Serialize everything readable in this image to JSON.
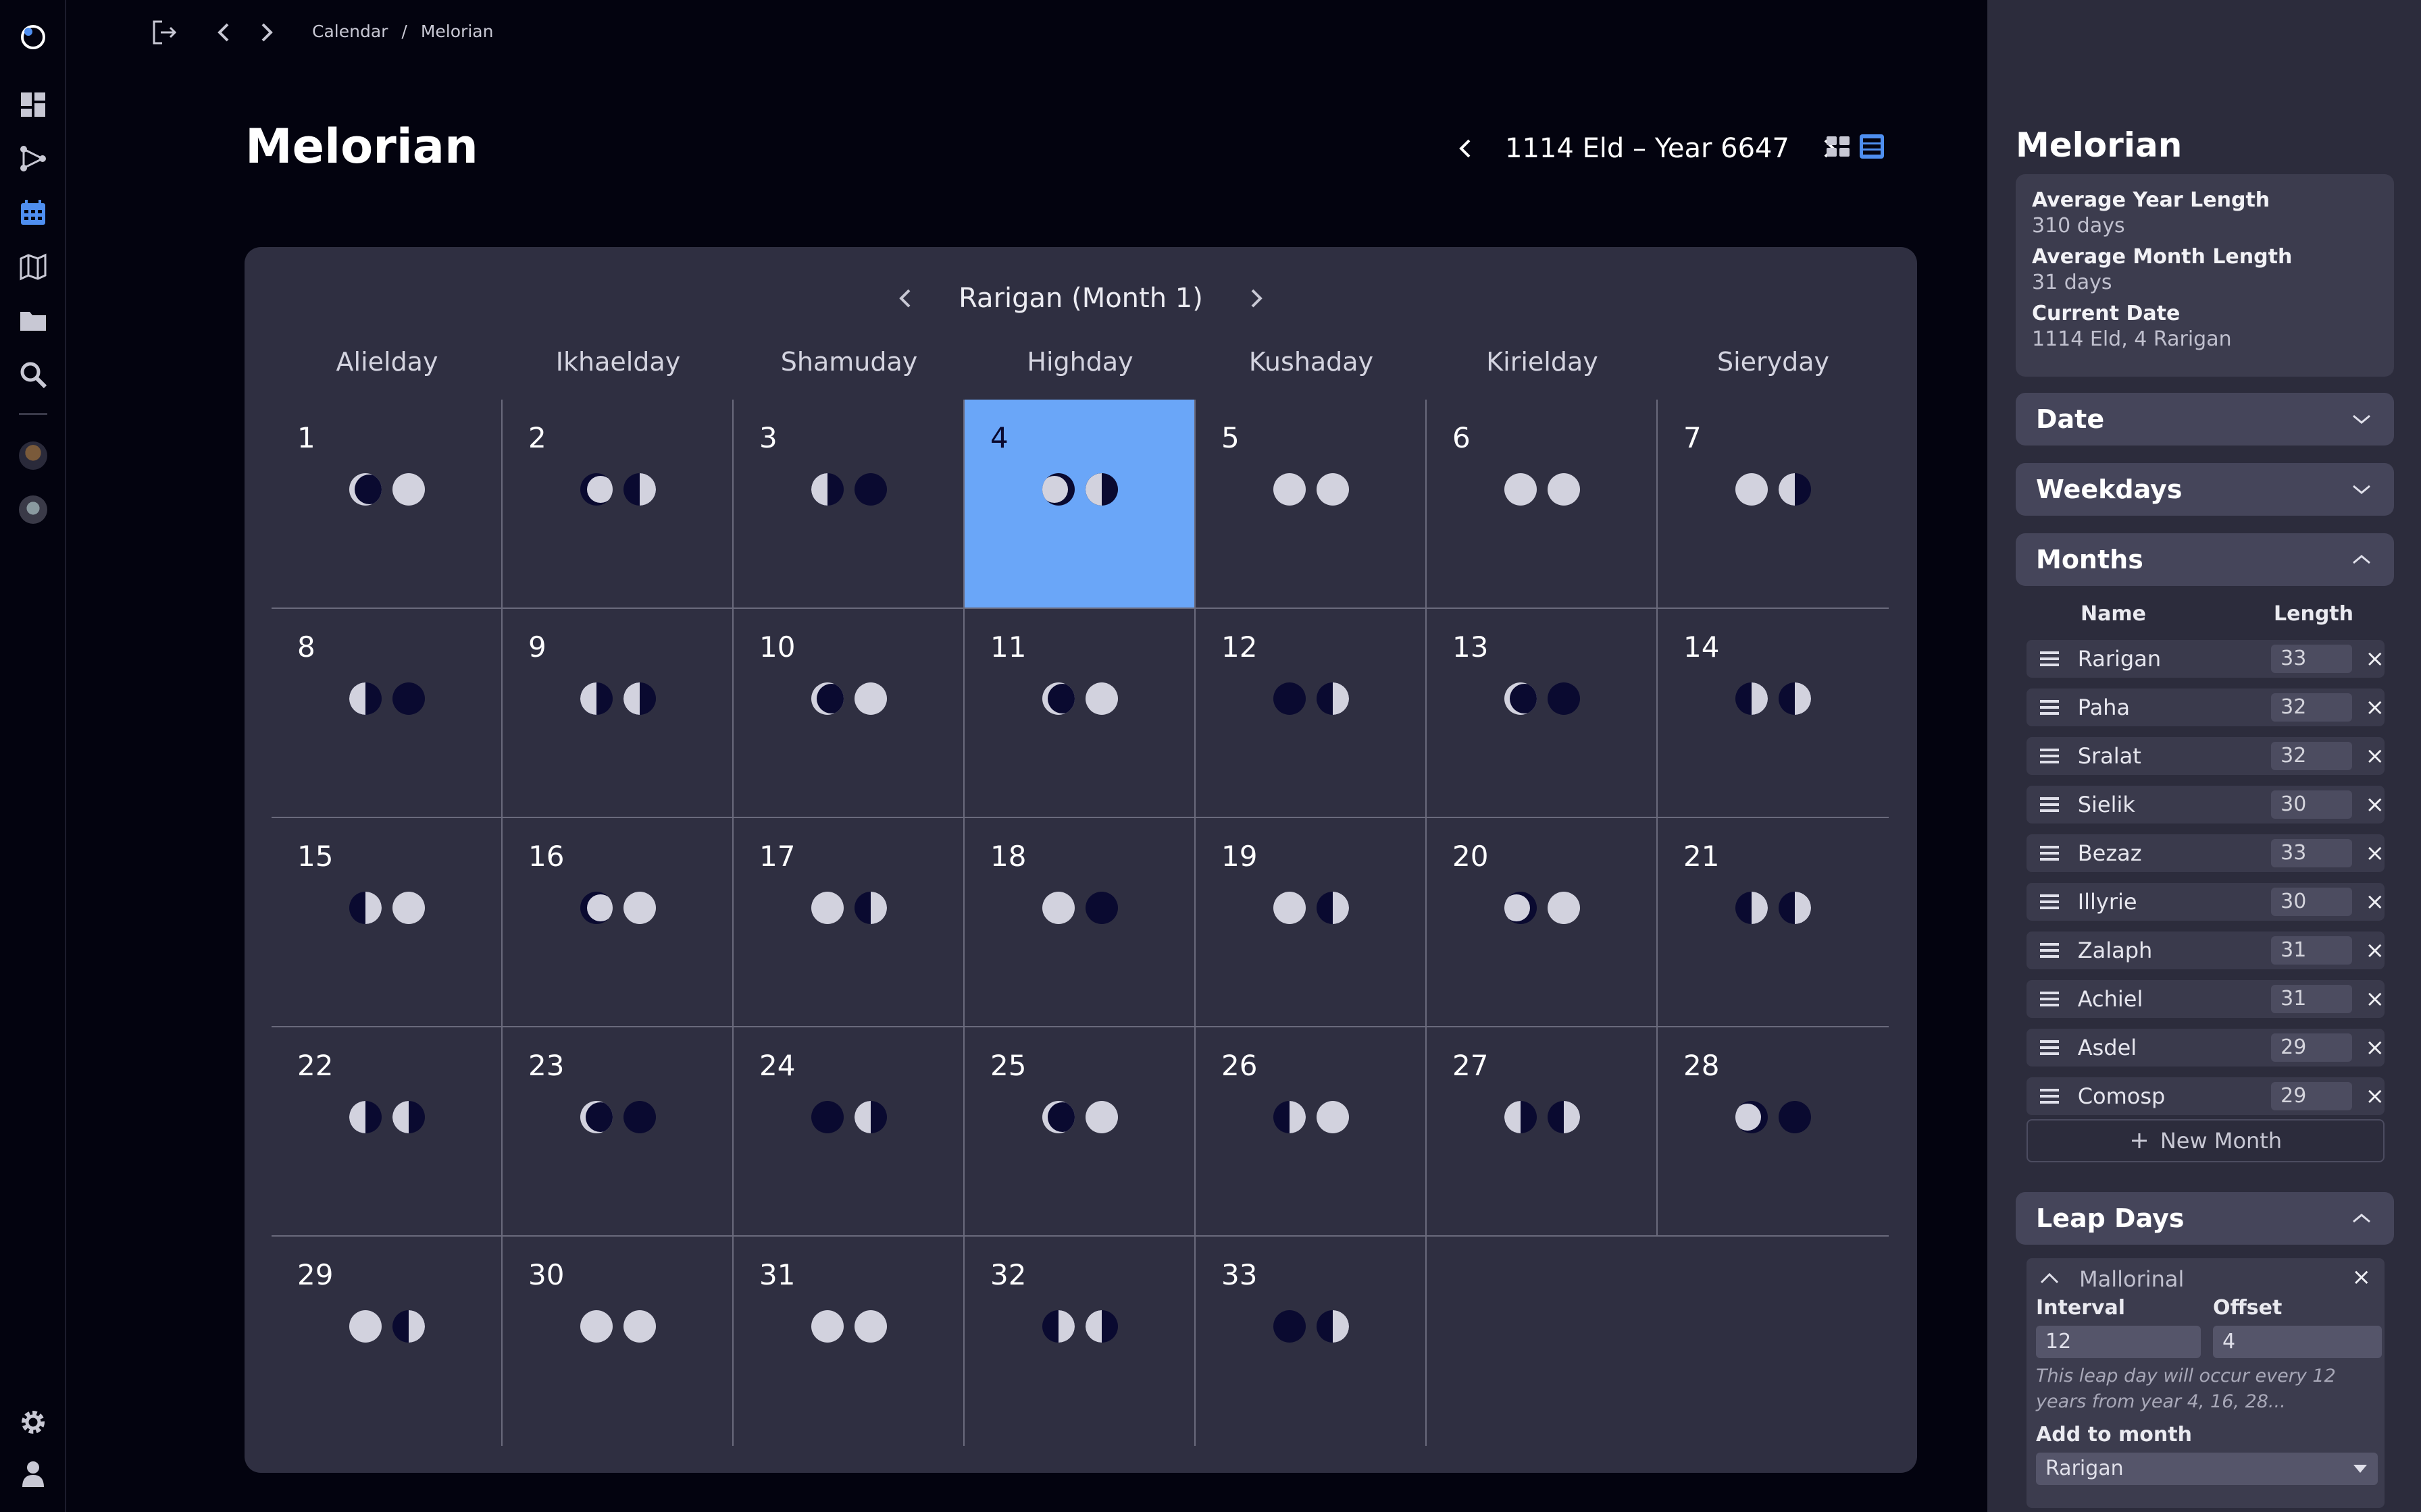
{
  "breadcrumb": [
    "Calendar",
    "/",
    "Melorian"
  ],
  "page_title": "Melorian",
  "year_label": "1114 Eld – Year 6647",
  "month_label": "Rarigan (Month 1)",
  "weekdays": [
    "Alielday",
    "Ikhaelday",
    "Shamuday",
    "Highday",
    "Kushaday",
    "Kirielday",
    "Sieryday"
  ],
  "today": 4,
  "colors": {
    "today": "#6aa6f8",
    "card": "#2f2f41",
    "moon_light": "#d2d2de",
    "moon_dark": "#0a0a30"
  },
  "days": [
    {
      "n": "1",
      "m": [
        "waxing-crescent",
        "full"
      ]
    },
    {
      "n": "2",
      "m": [
        "waxing-gibbous",
        "first-quarter"
      ]
    },
    {
      "n": "3",
      "m": [
        "last-quarter",
        "new"
      ]
    },
    {
      "n": "4",
      "m": [
        "waning-gibbous",
        "last-quarter"
      ]
    },
    {
      "n": "5",
      "m": [
        "full",
        "full"
      ]
    },
    {
      "n": "6",
      "m": [
        "full",
        "full"
      ]
    },
    {
      "n": "7",
      "m": [
        "full",
        "last-quarter"
      ]
    },
    {
      "n": "8",
      "m": [
        "last-quarter",
        "new"
      ]
    },
    {
      "n": "9",
      "m": [
        "last-quarter",
        "last-quarter"
      ]
    },
    {
      "n": "10",
      "m": [
        "waxing-crescent",
        "full"
      ]
    },
    {
      "n": "11",
      "m": [
        "waxing-crescent",
        "full"
      ]
    },
    {
      "n": "12",
      "m": [
        "new",
        "first-quarter"
      ]
    },
    {
      "n": "13",
      "m": [
        "waxing-crescent",
        "new"
      ]
    },
    {
      "n": "14",
      "m": [
        "first-quarter",
        "first-quarter"
      ]
    },
    {
      "n": "15",
      "m": [
        "first-quarter",
        "full"
      ]
    },
    {
      "n": "16",
      "m": [
        "waxing-gibbous",
        "full"
      ]
    },
    {
      "n": "17",
      "m": [
        "full",
        "first-quarter"
      ]
    },
    {
      "n": "18",
      "m": [
        "full",
        "new"
      ]
    },
    {
      "n": "19",
      "m": [
        "full",
        "first-quarter"
      ]
    },
    {
      "n": "20",
      "m": [
        "waning-gibbous",
        "full"
      ]
    },
    {
      "n": "21",
      "m": [
        "first-quarter",
        "first-quarter"
      ]
    },
    {
      "n": "22",
      "m": [
        "last-quarter",
        "last-quarter"
      ]
    },
    {
      "n": "23",
      "m": [
        "waxing-crescent",
        "new"
      ]
    },
    {
      "n": "24",
      "m": [
        "new",
        "last-quarter"
      ]
    },
    {
      "n": "25",
      "m": [
        "waxing-crescent",
        "full"
      ]
    },
    {
      "n": "26",
      "m": [
        "first-quarter",
        "full"
      ]
    },
    {
      "n": "27",
      "m": [
        "last-quarter",
        "first-quarter"
      ]
    },
    {
      "n": "28",
      "m": [
        "waning-gibbous",
        "new"
      ]
    },
    {
      "n": "29",
      "m": [
        "full",
        "first-quarter"
      ]
    },
    {
      "n": "30",
      "m": [
        "full",
        "full"
      ]
    },
    {
      "n": "31",
      "m": [
        "full",
        "full"
      ]
    },
    {
      "n": "32",
      "m": [
        "first-quarter",
        "last-quarter"
      ]
    },
    {
      "n": "33",
      "m": [
        "new",
        "first-quarter"
      ]
    }
  ],
  "panel": {
    "title": "Melorian",
    "stats": [
      {
        "label": "Average Year Length",
        "value": "310 days"
      },
      {
        "label": "Average Month Length",
        "value": "31 days"
      },
      {
        "label": "Current Date",
        "value": "1114 Eld, 4 Rarigan"
      }
    ],
    "sections": {
      "date": "Date",
      "weekdays": "Weekdays",
      "months": "Months",
      "leap_days": "Leap Days"
    },
    "months_header": {
      "name": "Name",
      "length": "Length"
    },
    "months": [
      {
        "name": "Rarigan",
        "length": "33"
      },
      {
        "name": "Paha",
        "length": "32"
      },
      {
        "name": "Sralat",
        "length": "32"
      },
      {
        "name": "Sielik",
        "length": "30"
      },
      {
        "name": "Bezaz",
        "length": "33"
      },
      {
        "name": "Illyrie",
        "length": "30"
      },
      {
        "name": "Zalaph",
        "length": "31"
      },
      {
        "name": "Achiel",
        "length": "31"
      },
      {
        "name": "Asdel",
        "length": "29"
      },
      {
        "name": "Comosp",
        "length": "29"
      }
    ],
    "remove_glyph": "×",
    "new_month_label": "New Month",
    "leap": {
      "name": "Mallorinal",
      "interval_label": "Interval",
      "interval_value": "12",
      "offset_label": "Offset",
      "offset_value": "4",
      "description": "This leap day will occur every 12 years from year 4, 16, 28...",
      "add_to_month_label": "Add to month",
      "add_to_month_value": "Rarigan"
    }
  }
}
